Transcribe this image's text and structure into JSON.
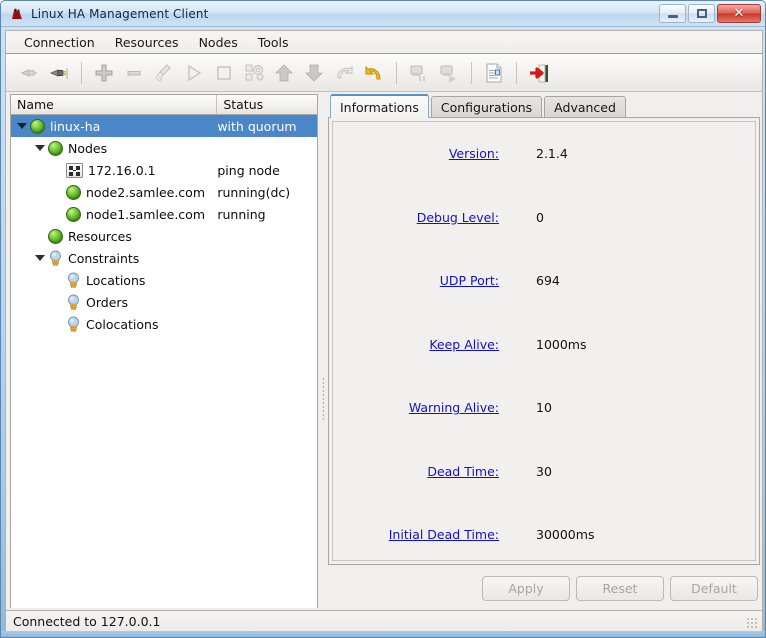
{
  "window": {
    "title": "Linux HA Management Client",
    "icon": "app-icon",
    "controls": {
      "minimize": "–",
      "maximize": "□",
      "close": "✕"
    }
  },
  "menubar": {
    "items": [
      {
        "label": "Connection"
      },
      {
        "label": "Resources"
      },
      {
        "label": "Nodes"
      },
      {
        "label": "Tools"
      }
    ]
  },
  "toolbar": {
    "items": [
      {
        "name": "disconnect-icon",
        "enabled": false
      },
      {
        "name": "connect-icon",
        "enabled": true
      },
      {
        "name": "separator"
      },
      {
        "name": "add-icon",
        "enabled": true
      },
      {
        "name": "remove-icon",
        "enabled": false
      },
      {
        "name": "cleanup-broom-icon",
        "enabled": false
      },
      {
        "name": "start-play-icon",
        "enabled": false
      },
      {
        "name": "stop-square-icon",
        "enabled": false
      },
      {
        "name": "migrate-gears-icon",
        "enabled": false
      },
      {
        "name": "move-up-arrow-icon",
        "enabled": false
      },
      {
        "name": "move-down-arrow-icon",
        "enabled": false
      },
      {
        "name": "redo-arrow-icon",
        "enabled": false
      },
      {
        "name": "undo-arrow-icon",
        "enabled": true
      },
      {
        "name": "separator"
      },
      {
        "name": "standby-node-icon",
        "enabled": false
      },
      {
        "name": "activate-node-icon",
        "enabled": false
      },
      {
        "name": "separator"
      },
      {
        "name": "document-icon",
        "enabled": false
      },
      {
        "name": "separator"
      },
      {
        "name": "exit-door-icon",
        "enabled": true
      }
    ]
  },
  "tree": {
    "columns": [
      {
        "key": "name",
        "label": "Name"
      },
      {
        "key": "status",
        "label": "Status"
      }
    ],
    "rows": [
      {
        "indent": 0,
        "twisty": "expanded",
        "icon": "green-node-icon",
        "name": "linux-ha",
        "status": "with quorum",
        "selected": true
      },
      {
        "indent": 1,
        "twisty": "expanded",
        "icon": "green-node-icon",
        "name": "Nodes",
        "status": "",
        "selected": false
      },
      {
        "indent": 2,
        "twisty": "none",
        "icon": "ping-node-icon",
        "name": "172.16.0.1",
        "status": "ping node",
        "selected": false
      },
      {
        "indent": 2,
        "twisty": "none",
        "icon": "green-node-icon",
        "name": "node2.samlee.com",
        "status": "running(dc)",
        "selected": false
      },
      {
        "indent": 2,
        "twisty": "none",
        "icon": "green-node-icon",
        "name": "node1.samlee.com",
        "status": "running",
        "selected": false
      },
      {
        "indent": 1,
        "twisty": "none",
        "icon": "green-node-icon",
        "name": "Resources",
        "status": "",
        "selected": false
      },
      {
        "indent": 1,
        "twisty": "expanded",
        "icon": "bulb-icon",
        "name": "Constraints",
        "status": "",
        "selected": false
      },
      {
        "indent": 2,
        "twisty": "none",
        "icon": "bulb-icon",
        "name": "Locations",
        "status": "",
        "selected": false
      },
      {
        "indent": 2,
        "twisty": "none",
        "icon": "bulb-icon",
        "name": "Orders",
        "status": "",
        "selected": false
      },
      {
        "indent": 2,
        "twisty": "none",
        "icon": "bulb-icon",
        "name": "Colocations",
        "status": "",
        "selected": false
      }
    ]
  },
  "tabs": [
    {
      "label": "Informations",
      "active": true
    },
    {
      "label": "Configurations",
      "active": false
    },
    {
      "label": "Advanced",
      "active": false
    }
  ],
  "information": {
    "fields": [
      {
        "label": "Version:",
        "value": "2.1.4"
      },
      {
        "label": "Debug Level:",
        "value": "0"
      },
      {
        "label": "UDP Port:",
        "value": "694"
      },
      {
        "label": "Keep Alive:",
        "value": "1000ms"
      },
      {
        "label": "Warning Alive:",
        "value": "10"
      },
      {
        "label": "Dead Time:",
        "value": "30"
      },
      {
        "label": "Initial Dead Time:",
        "value": "30000ms"
      }
    ]
  },
  "buttons": [
    {
      "label": "Apply",
      "enabled": false
    },
    {
      "label": "Reset",
      "enabled": false
    },
    {
      "label": "Default",
      "enabled": false
    }
  ],
  "statusbar": {
    "text": "Connected to 127.0.0.1"
  },
  "colors": {
    "selection": "#4a86c8",
    "link": "#1111cc",
    "node_green": "#4ca81e",
    "titlebar": "#cfe2f3"
  }
}
